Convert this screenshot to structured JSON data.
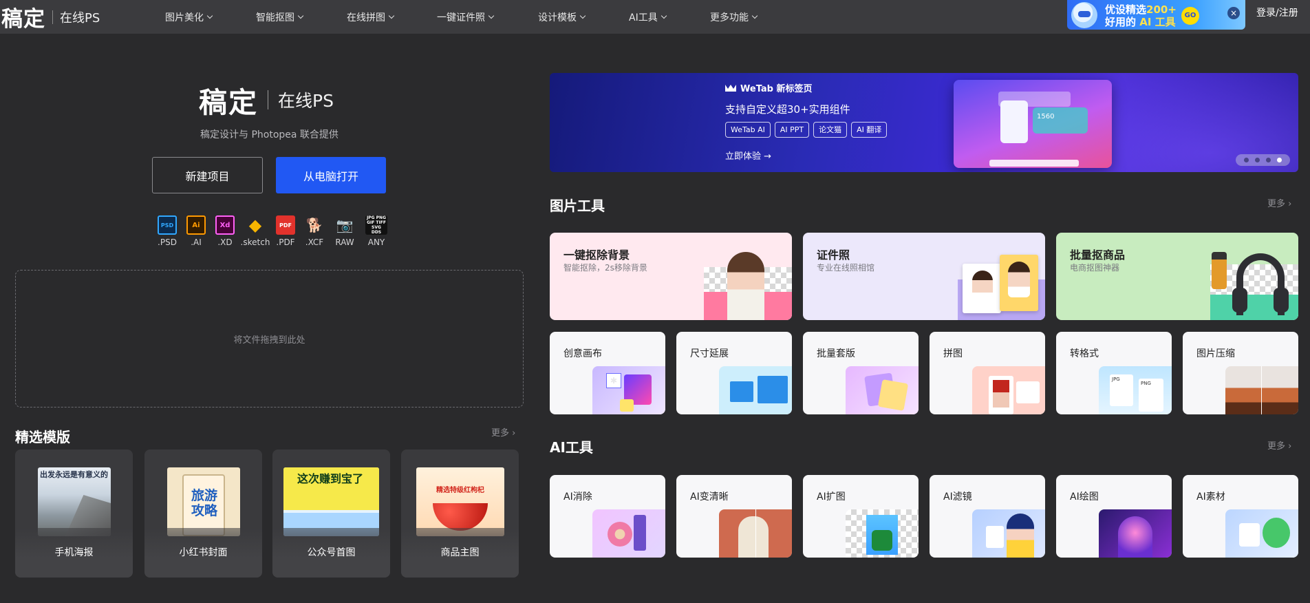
{
  "brand": {
    "logo": "稿定",
    "sub": "在线PS"
  },
  "nav": {
    "items": [
      {
        "label": "图片美化"
      },
      {
        "label": "智能抠图"
      },
      {
        "label": "在线拼图"
      },
      {
        "label": "一键证件照"
      },
      {
        "label": "设计模板"
      },
      {
        "label": "AI工具"
      },
      {
        "label": "更多功能"
      }
    ],
    "promo": {
      "line1_a": "优设精选",
      "line1_b": "200+",
      "line2_a": "好用的 ",
      "line2_b": "AI 工具",
      "go": "GO",
      "close": "×"
    },
    "login": "登录/注册"
  },
  "hero": {
    "logo": "稿定",
    "ps": "在线PS",
    "desc": "稿定设计与 Photopea 联合提供",
    "btn_new": "新建项目",
    "btn_open": "从电脑打开",
    "formats": [
      {
        "label": ".PSD",
        "icon": "PSD",
        "color": "#31a8ff",
        "bg": "#0b2b4f"
      },
      {
        "label": ".AI",
        "icon": "Ai",
        "color": "#ff9a00",
        "bg": "#331c00"
      },
      {
        "label": ".XD",
        "icon": "Xd",
        "color": "#ff61f6",
        "bg": "#470137"
      },
      {
        "label": ".sketch",
        "icon": "◆",
        "color": "#f7b500",
        "bg": "transparent"
      },
      {
        "label": ".PDF",
        "icon": "PDF",
        "color": "#ffffff",
        "bg": "#e2322c"
      },
      {
        "label": ".XCF",
        "icon": "🐕",
        "color": "#cfcfcf",
        "bg": "transparent"
      },
      {
        "label": "RAW",
        "icon": "📷",
        "color": "#cfcfcf",
        "bg": "transparent"
      },
      {
        "label": "ANY",
        "icon": "JPG PNG GIF TIFF SVG DDS",
        "color": "#ffffff",
        "bg": "#111"
      }
    ],
    "dropzone": "将文件拖拽到此处"
  },
  "templates": {
    "title": "精选模版",
    "more": "更多 ›",
    "items": [
      {
        "label": "手机海报",
        "thumb_title": "出发永远是有意义的"
      },
      {
        "label": "小红书封面",
        "thumb_title": "旅游攻略"
      },
      {
        "label": "公众号首图",
        "thumb_title": "这次赚到宝了"
      },
      {
        "label": "商品主图",
        "thumb_title": "精选特级红枸杞"
      }
    ]
  },
  "banner": {
    "brand": "WeTab 新标签页",
    "line": "支持自定义超30+实用组件",
    "tags": [
      "WeTab AI",
      "AI PPT",
      "论文猫",
      "AI 翻译"
    ],
    "cta": "立即体验  →",
    "screen_number": "1560",
    "active_dot": 3
  },
  "image_tools": {
    "title": "图片工具",
    "more": "更多 ›",
    "big": [
      {
        "title": "一键抠除背景",
        "sub": "智能抠除，2s移除背景"
      },
      {
        "title": "证件照",
        "sub": "专业在线照相馆"
      },
      {
        "title": "批量抠商品",
        "sub": "电商抠图神器"
      }
    ],
    "small": [
      {
        "title": "创意画布"
      },
      {
        "title": "尺寸延展"
      },
      {
        "title": "批量套版"
      },
      {
        "title": "拼图"
      },
      {
        "title": "转格式"
      },
      {
        "title": "图片压缩"
      }
    ]
  },
  "ai_tools": {
    "title": "AI工具",
    "more": "更多 ›",
    "items": [
      {
        "title": "AI消除"
      },
      {
        "title": "AI变清晰"
      },
      {
        "title": "AI扩图"
      },
      {
        "title": "AI滤镜"
      },
      {
        "title": "AI绘图"
      },
      {
        "title": "AI素材"
      }
    ]
  },
  "colors": {
    "accent": "#2158f3",
    "page_bg": "#2a2a2c",
    "topbar_bg": "#3b3b3e"
  }
}
